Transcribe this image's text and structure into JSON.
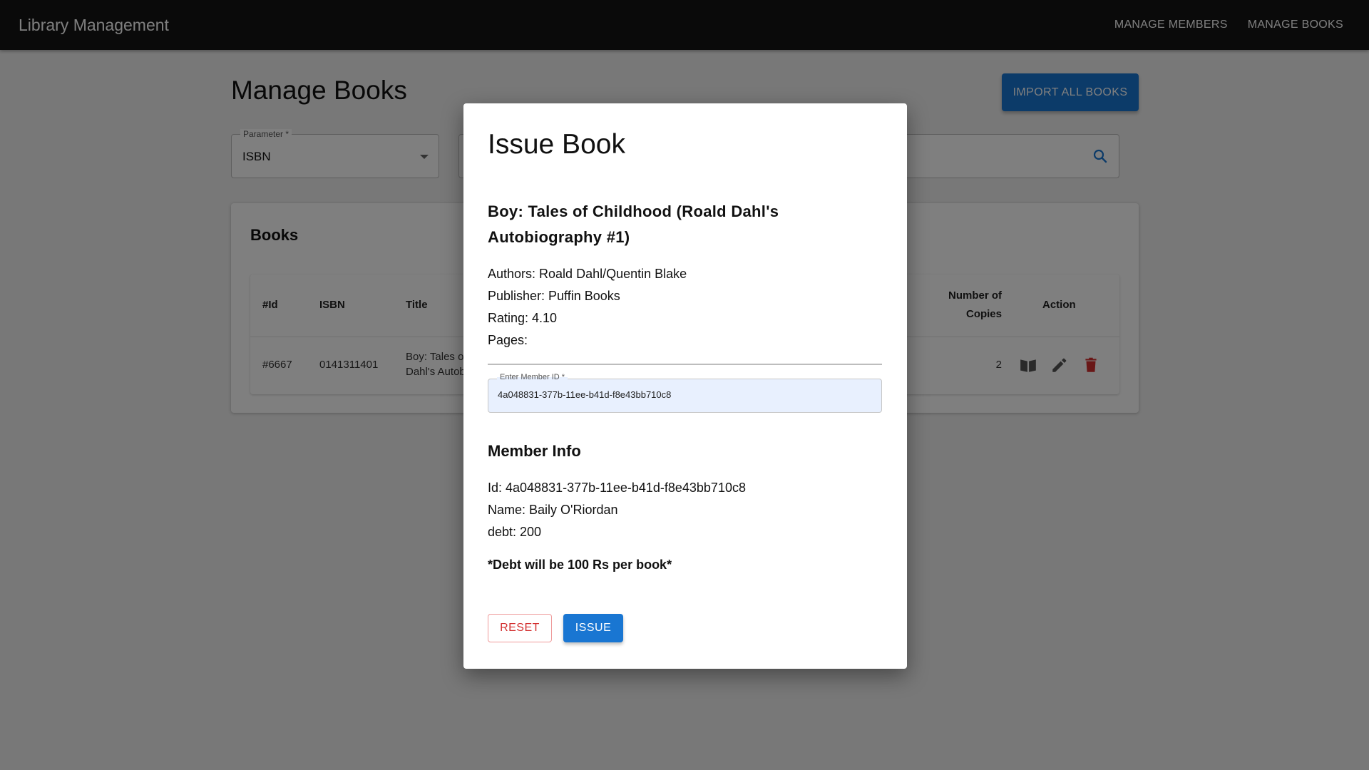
{
  "appbar": {
    "title": "Library Management",
    "nav": [
      "MANAGE MEMBERS",
      "MANAGE BOOKS"
    ]
  },
  "page": {
    "title": "Manage Books",
    "import_button": "IMPORT ALL BOOKS",
    "parameter": {
      "label": "Parameter *",
      "value": "ISBN"
    },
    "books_card_title": "Books",
    "table": {
      "headers": {
        "id": "#Id",
        "isbn": "ISBN",
        "title": "Title",
        "copies_line1": "Number of",
        "copies_line2": "Copies",
        "action": "Action"
      },
      "rows": [
        {
          "id": "#6667",
          "isbn": "0141311401",
          "title_line1": "Boy: Tales o",
          "title_line2": "Dahl's Autob",
          "copies": "2"
        }
      ]
    }
  },
  "modal": {
    "title": "Issue Book",
    "book_title": "Boy: Tales of Childhood (Roald Dahl's Autobiography #1)",
    "authors": "Authors: Roald Dahl/Quentin Blake",
    "publisher": "Publisher: Puffin Books",
    "rating": "Rating: 4.10",
    "pages": "Pages:",
    "member_field": {
      "label": "Enter Member ID *",
      "value": "4a048831-377b-11ee-b41d-f8e43bb710c8"
    },
    "member_info": {
      "heading": "Member Info",
      "id": "Id: 4a048831-377b-11ee-b41d-f8e43bb710c8",
      "name": "Name: Baily O'Riordan",
      "debt": "debt: 200"
    },
    "debt_note": "*Debt will be 100 Rs per book*",
    "reset_label": "RESET",
    "issue_label": "ISSUE"
  },
  "icons": {
    "search": "search-icon",
    "issue_book": "book-open-icon",
    "edit": "pencil-icon",
    "delete": "trash-icon",
    "dropdown": "caret-down-icon"
  },
  "colors": {
    "primary": "#1976d2",
    "danger": "#d32f2f",
    "appbar": "#151515"
  }
}
